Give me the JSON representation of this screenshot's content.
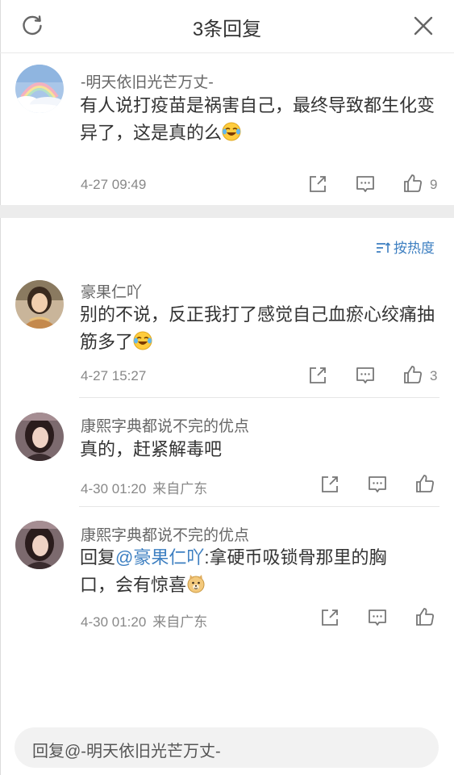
{
  "header": {
    "title": "3条回复",
    "refresh_icon": "refresh-icon",
    "close_icon": "close-icon"
  },
  "root_comment": {
    "username": "-明天依旧光芒万丈-",
    "text": "有人说打疫苗是祸害自己，最终导致都生化变异了，这是真的么",
    "emoji": "laughing-crying-emoji",
    "time": "4-27 09:49",
    "like_count": "9"
  },
  "sort": {
    "label": "按热度"
  },
  "replies": [
    {
      "username": "豪果仁吖",
      "text": "别的不说，反正我打了感觉自己血瘀心绞痛抽筋多了",
      "emoji": "laughing-crying-emoji",
      "time": "4-27 15:27",
      "location": "",
      "like_count": "3"
    },
    {
      "username": "康熙字典都说不完的优点",
      "text": "真的，赶紧解毒吧",
      "time": "4-30 01:20",
      "location": "来自广东",
      "like_count": ""
    },
    {
      "username": "康熙字典都说不完的优点",
      "reply_prefix": "回复",
      "mention": "@豪果仁吖",
      "text": ":拿硬币吸锁骨那里的胸口，会有惊喜",
      "emoji": "doge-emoji",
      "time": "4-30 01:20",
      "location": "来自广东",
      "like_count": ""
    }
  ],
  "reply_input": {
    "placeholder": "回复@-明天依旧光芒万丈-"
  },
  "colors": {
    "accent": "#3d7fc1",
    "text": "#333333",
    "meta": "#888888",
    "divider": "#e6e6e6"
  }
}
